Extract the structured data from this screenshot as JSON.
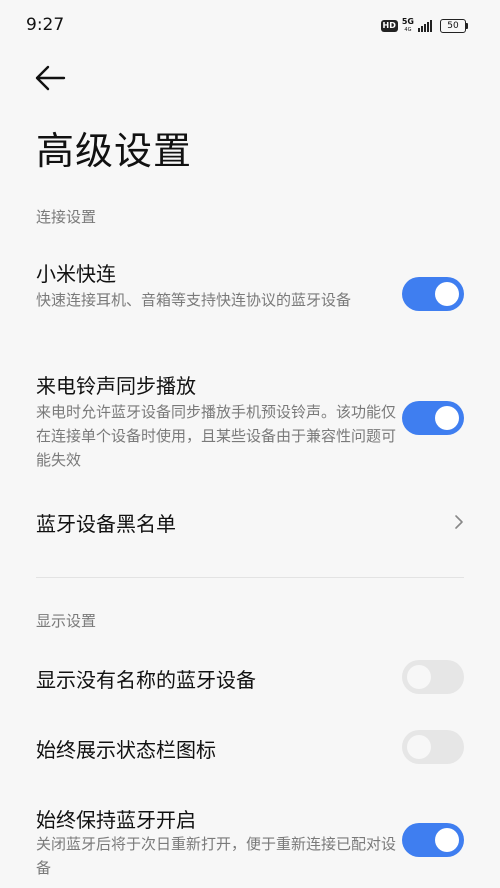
{
  "status": {
    "time": "9:27",
    "hd": "HD",
    "network": "5G",
    "network_sub": "4G",
    "battery": "50"
  },
  "title": "高级设置",
  "sections": [
    {
      "header": "连接设置",
      "items": [
        {
          "title": "小米快连",
          "subtitle": "快速连接耳机、音箱等支持快连协议的蓝牙设备",
          "toggle": true
        },
        {
          "title": "来电铃声同步播放",
          "subtitle": "来电时允许蓝牙设备同步播放手机预设铃声。该功能仅在连接单个设备时使用，且某些设备由于兼容性问题可能失效",
          "toggle": true
        },
        {
          "title": "蓝牙设备黑名单",
          "chevron": true
        }
      ]
    },
    {
      "header": "显示设置",
      "items": [
        {
          "title": "显示没有名称的蓝牙设备",
          "toggle": false
        },
        {
          "title": "始终展示状态栏图标",
          "toggle": false
        },
        {
          "title": "始终保持蓝牙开启",
          "subtitle": "关闭蓝牙后将于次日重新打开，便于重新连接已配对设备",
          "toggle": true
        }
      ]
    }
  ],
  "colors": {
    "accent": "#3f7ef0",
    "toggle_off": "#e6e6e6",
    "background": "#f7f7f7"
  }
}
